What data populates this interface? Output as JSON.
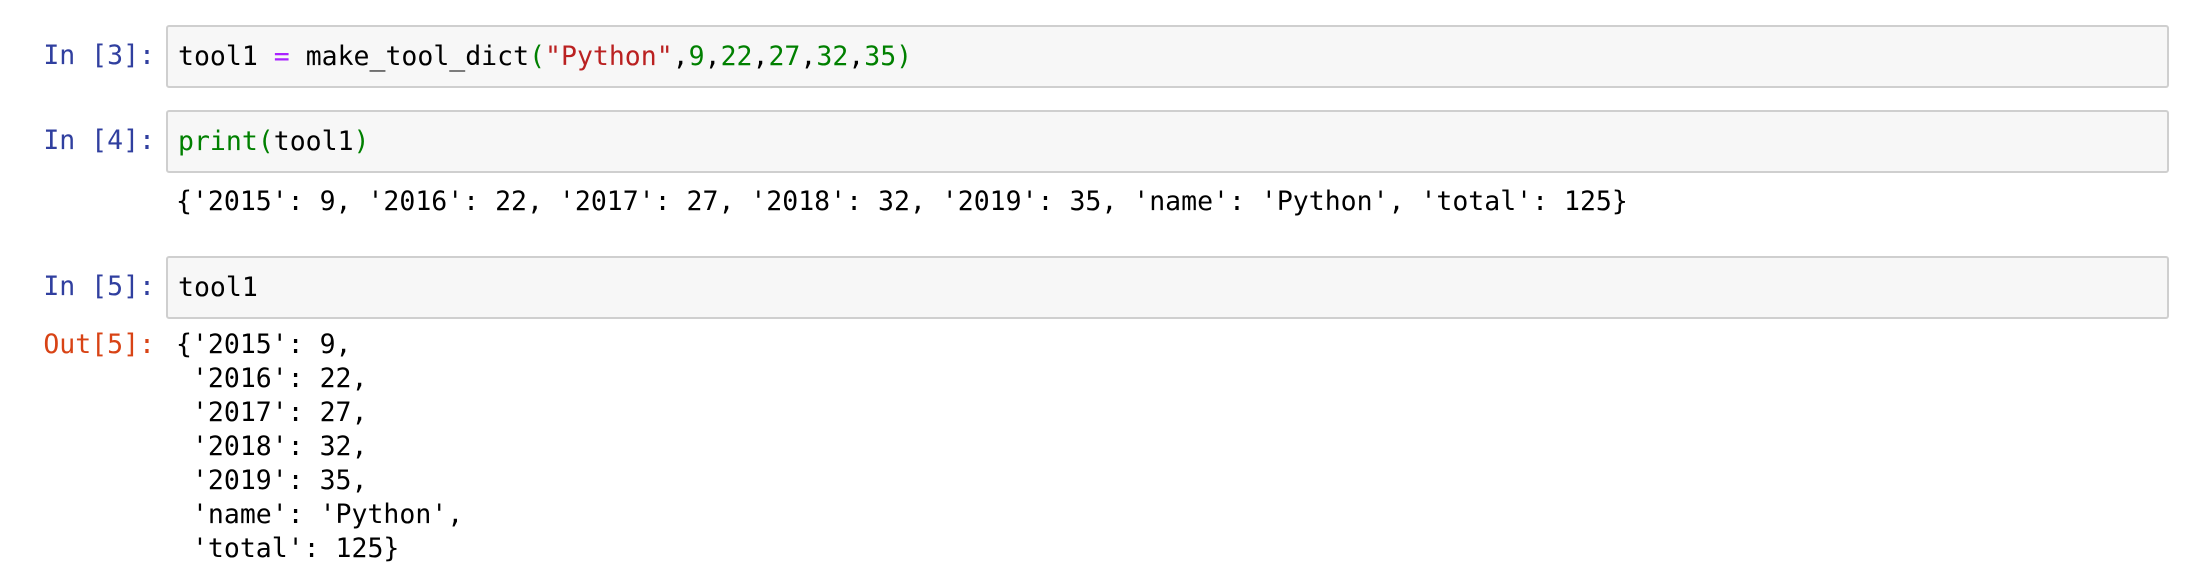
{
  "cells": [
    {
      "prompt": "In [3]:",
      "code": {
        "var": "tool1",
        "assign": "=",
        "func": "make_tool_dict",
        "open": "(",
        "str_arg": "\"Python\"",
        "comma": ",",
        "nums": [
          "9",
          "22",
          "27",
          "32",
          "35"
        ],
        "close": ")"
      }
    },
    {
      "prompt": "In [4]:",
      "code": {
        "builtin": "print",
        "open": "(",
        "arg": "tool1",
        "close": ")"
      },
      "stream_output": "{'2015': 9, '2016': 22, '2017': 27, '2018': 32, '2019': 35, 'name': 'Python', 'total': 125}"
    },
    {
      "prompt": "In [5]:",
      "code": {
        "text": "tool1"
      },
      "out_prompt": "Out[5]:",
      "result_lines": [
        "{'2015': 9,",
        " '2016': 22,",
        " '2017': 27,",
        " '2018': 32,",
        " '2019': 35,",
        " 'name': 'Python',",
        " 'total': 125}"
      ]
    }
  ],
  "colors": {
    "in_prompt": "#303f9f",
    "out_prompt": "#d84315",
    "string": "#ba2121",
    "number": "#008000",
    "operator": "#aa22ff",
    "builtin": "#008000",
    "input_bg": "#f7f7f7",
    "input_border": "#cfcfcf"
  }
}
